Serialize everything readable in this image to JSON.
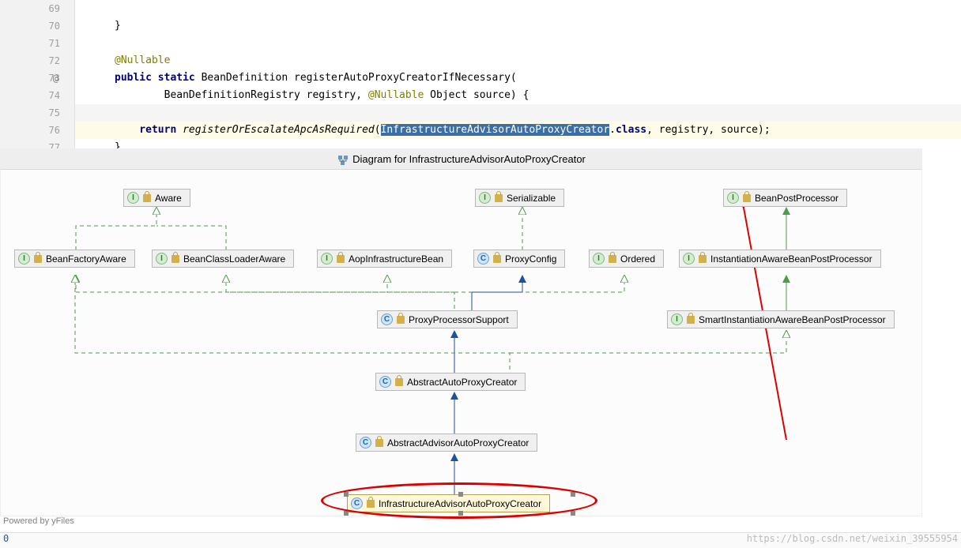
{
  "code": {
    "lines": [
      {
        "num": "69",
        "gutter_at": ""
      },
      {
        "num": "70",
        "gutter_at": ""
      },
      {
        "num": "71",
        "gutter_at": ""
      },
      {
        "num": "72",
        "gutter_at": ""
      },
      {
        "num": "73",
        "gutter_at": "@"
      },
      {
        "num": "74",
        "gutter_at": ""
      },
      {
        "num": "75",
        "gutter_at": ""
      },
      {
        "num": "76",
        "gutter_at": ""
      },
      {
        "num": "77",
        "gutter_at": ""
      }
    ],
    "l70": "}",
    "l72": "@Nullable",
    "l73_pub": "public ",
    "l73_static": "static ",
    "l73_rest": "BeanDefinition registerAutoProxyCreatorIfNecessary(",
    "l74_pad": "        BeanDefinitionRegistry registry, ",
    "l74_ann": "@Nullable",
    "l74_rest": " Object source) {",
    "l76_ret": "    return ",
    "l76_fn": "registerOrEscalateApcAsRequired",
    "l76_open": "(",
    "l76_sel": "InfrastructureAdvisorAutoProxyCreator",
    "l76_dot": ".",
    "l76_class": "class",
    "l76_rest": ", registry, source);",
    "l77": "}"
  },
  "diagram": {
    "title": "Diagram for InfrastructureAdvisorAutoProxyCreator",
    "nodes": {
      "aware": {
        "type": "I",
        "label": "Aware"
      },
      "serializable": {
        "type": "I",
        "label": "Serializable"
      },
      "bpp": {
        "type": "I",
        "label": "BeanPostProcessor"
      },
      "bfa": {
        "type": "I",
        "label": "BeanFactoryAware"
      },
      "bcla": {
        "type": "I",
        "label": "BeanClassLoaderAware"
      },
      "aop": {
        "type": "I",
        "label": "AopInfrastructureBean"
      },
      "proxy": {
        "type": "C",
        "label": "ProxyConfig"
      },
      "ordered": {
        "type": "I",
        "label": "Ordered"
      },
      "iabpp": {
        "type": "I",
        "label": "InstantiationAwareBeanPostProcessor"
      },
      "pps": {
        "type": "C",
        "label": "ProxyProcessorSupport"
      },
      "siabpp": {
        "type": "I",
        "label": "SmartInstantiationAwareBeanPostProcessor"
      },
      "aapc": {
        "type": "C",
        "label": "AbstractAutoProxyCreator"
      },
      "aaapc": {
        "type": "C",
        "label": "AbstractAdvisorAutoProxyCreator"
      },
      "iaapc": {
        "type": "C",
        "label": "InfrastructureAdvisorAutoProxyCreator"
      }
    }
  },
  "footer": {
    "powered": "Powered by yFiles",
    "zero": "0",
    "watermark": "https://blog.csdn.net/weixin_39555954"
  }
}
